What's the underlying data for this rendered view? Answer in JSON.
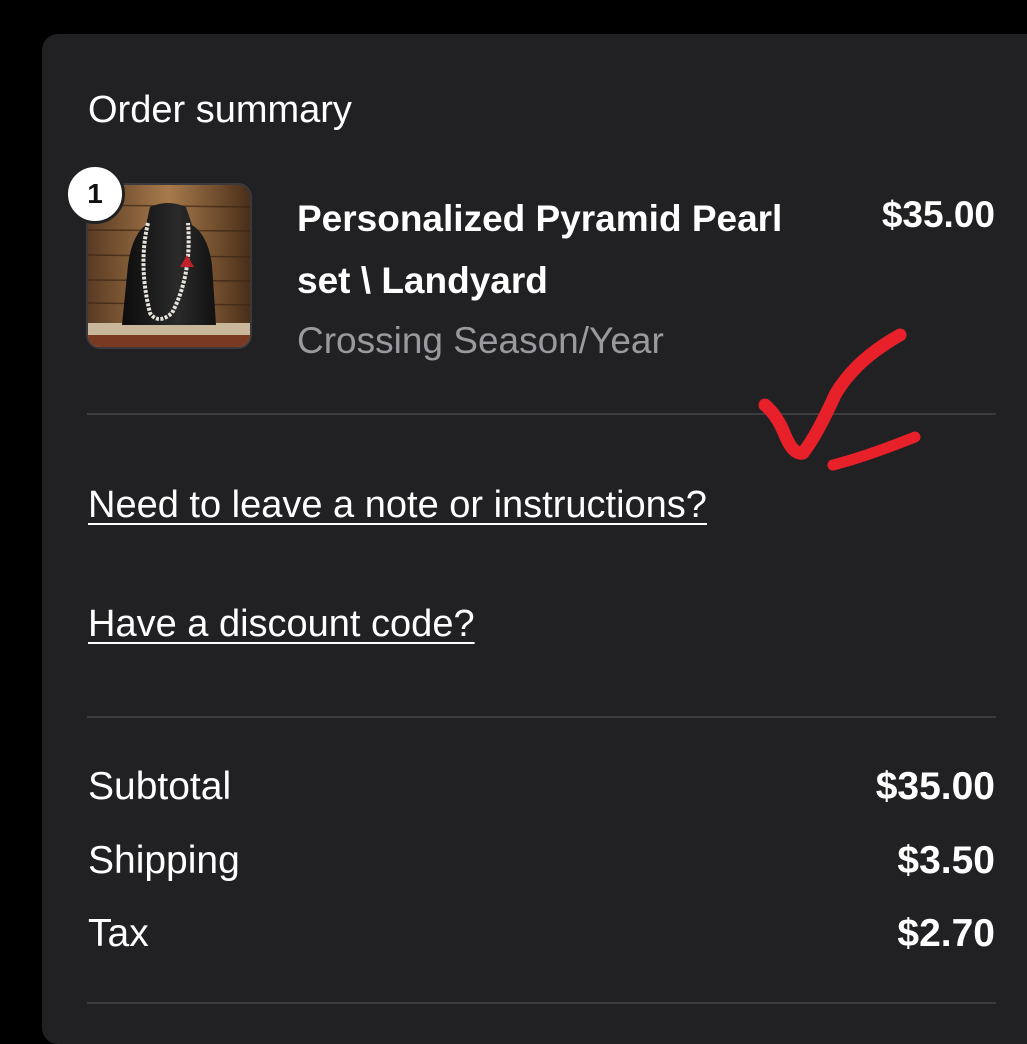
{
  "order_summary": {
    "title": "Order summary",
    "item": {
      "quantity": "1",
      "name": "Personalized Pyramid Pearl set \\ Landyard",
      "variant": "Crossing Season/Year",
      "price": "$35.00"
    },
    "note_link": "Need to leave a note or instructions?",
    "discount_link": "Have a discount code?",
    "totals": {
      "subtotal_label": "Subtotal",
      "subtotal_value": "$35.00",
      "shipping_label": "Shipping",
      "shipping_value": "$3.50",
      "tax_label": "Tax",
      "tax_value": "$2.70"
    }
  },
  "annotation": {
    "icon": "red-checkmark-icon",
    "color": "#e8202a"
  }
}
